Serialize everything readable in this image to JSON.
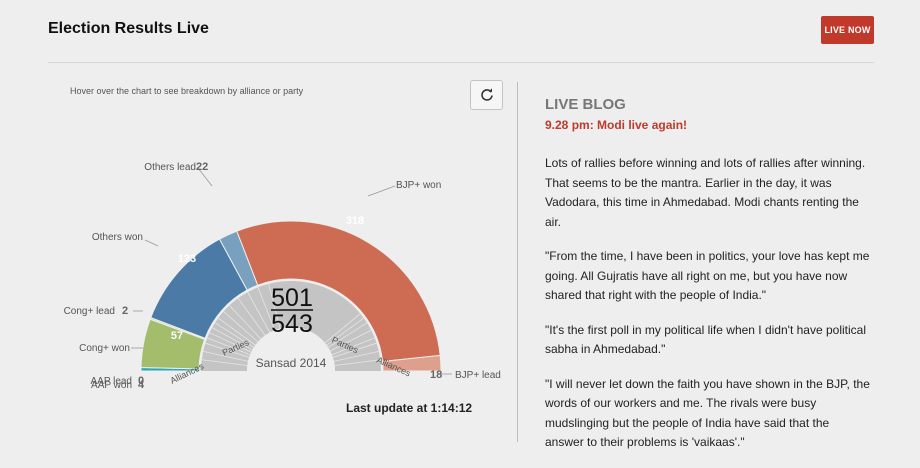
{
  "header": {
    "title": "Election Results Live",
    "live_badge": "LIVE NOW"
  },
  "chart_panel": {
    "hint": "Hover over the chart to see breakdown by alliance or party",
    "last_update": "Last update at 1:14:12"
  },
  "chart_data": {
    "type": "pie",
    "title": "Sansad 2014",
    "center_numerator": "501",
    "center_denominator": "543",
    "inner_ring_labels": [
      "Alliances",
      "Parties",
      "Parties",
      "Alliances"
    ],
    "series": [
      {
        "name": "AAP won",
        "value": 4,
        "color": "#2aa7b8"
      },
      {
        "name": "AAP lead",
        "value": 0,
        "color": "#2aa7b8"
      },
      {
        "name": "Cong+ won",
        "value": 57,
        "color": "#a4bd6c"
      },
      {
        "name": "Cong+ lead",
        "value": 2,
        "color": "#c9dba3"
      },
      {
        "name": "Others won",
        "value": 123,
        "color": "#4a7aa5"
      },
      {
        "name": "Others lead",
        "value": 22,
        "color": "#7aa0bf"
      },
      {
        "name": "BJP+ won",
        "value": 318,
        "color": "#cd6c53"
      },
      {
        "name": "BJP+ lead",
        "value": 18,
        "color": "#dca08d"
      }
    ],
    "outer_labels": {
      "aap_won": {
        "label": "AAP won",
        "value": "4"
      },
      "aap_lead": {
        "label": "AAP lead",
        "value": "0"
      },
      "cong_won": {
        "label": "Cong+ won",
        "value": "57"
      },
      "cong_lead": {
        "label": "Cong+ lead",
        "value": "2"
      },
      "others_won": {
        "label": "Others won",
        "value": "123"
      },
      "others_lead": {
        "label": "Others lead",
        "value": "22"
      },
      "bjp_won": {
        "label": "BJP+ won",
        "value": "318"
      },
      "bjp_lead": {
        "label": "BJP+ lead",
        "value": "18"
      }
    }
  },
  "blog": {
    "heading": "LIVE BLOG",
    "time_title": "9.28 pm: Modi live again!",
    "paragraphs": [
      "Lots of rallies before winning and lots of rallies after winning. That seems to be the mantra. Earlier in the day, it was Vadodara, this time in Ahmedabad. Modi chants renting the air.",
      "\"From the time, I have been in politics, your love has kept me going. All Gujratis have all right on me, but you have now shared that right with the people of India.\"",
      "\"It's the first poll in my political life when I didn't have political sabha in Ahmedabad.\"",
      "\"I will never let down the faith you have shown in the BJP, the words of our workers and me. The rivals were busy mudslinging but the people of India have said that the answer to their problems is 'vaikaas'.\""
    ]
  },
  "colors": {
    "live_badge": "#c0392b",
    "blog_time": "#c0392b",
    "bjp_won": "#cd6c53",
    "others_won": "#4a7aa5",
    "cong_won": "#a4bd6c",
    "aap": "#2aa7b8"
  }
}
